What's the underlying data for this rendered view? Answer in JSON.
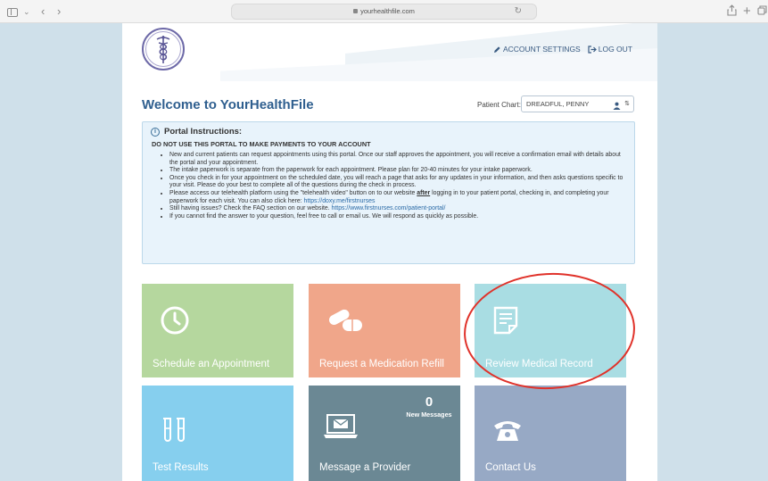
{
  "browser": {
    "url": "yourhealthfile.com"
  },
  "header": {
    "account_settings": "ACCOUNT SETTINGS",
    "log_out": "LOG OUT"
  },
  "welcome": {
    "title": "Welcome to YourHealthFile",
    "patient_chart_label": "Patient Chart:",
    "patient_chart_value": "DREADFUL, PENNY"
  },
  "instructions": {
    "title": "Portal Instructions:",
    "warning": "DO NOT USE THIS PORTAL TO MAKE PAYMENTS TO YOUR ACCOUNT",
    "items": [
      "New and current patients can request appointments using this portal. Once our staff approves the appointment, you will receive a confirmation email with details about the portal and your appointment.",
      "The intake paperwork is separate from the paperwork for each appointment. Please plan for 20-40 minutes for your intake paperwork.",
      "Once you check in for your appointment on the scheduled date, you will reach a page that asks for any updates in your information, and then asks questions specific to your visit. Please do your best to complete all of the questions during the check in process."
    ],
    "telehealth": {
      "before": "Please access our telehealth platform using the \"telehealth video\" button on to our website ",
      "emphasis": "after",
      "after": " logging in to your patient portal, checking in, and completing your paperwork for each visit. You can also click here: ",
      "link": "https://doxy.me/firstnurses"
    },
    "faq": {
      "before": "Still having issues? Check the FAQ section on our website. ",
      "link": "https://www.firstnurses.com/patient-portal/"
    },
    "last": "If you cannot find the answer to your question, feel free to call or email us. We will respond as quickly as possible."
  },
  "tiles": {
    "schedule": "Schedule an Appointment",
    "refill": "Request a Medication Refill",
    "record": "Review Medical Record",
    "tests": "Test Results",
    "message": "Message a Provider",
    "message_count": "0",
    "message_count_label": "New Messages",
    "contact": "Contact Us"
  },
  "colors": {
    "schedule": "#b5d79e",
    "refill": "#f0a68a",
    "record": "#a9dde3",
    "tests": "#86cfee",
    "message": "#6b8894",
    "contact": "#97a9c5",
    "annotation": "#e0322a"
  }
}
